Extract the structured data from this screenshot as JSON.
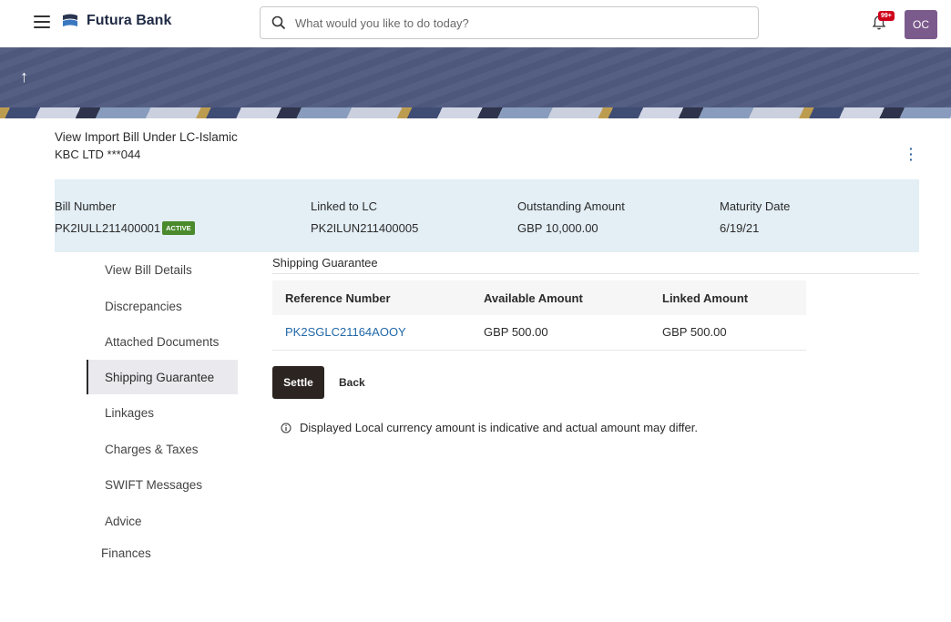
{
  "header": {
    "brand_name": "Futura Bank",
    "search_placeholder": "What would you like to do today?",
    "notification_badge": "99+",
    "avatar_initials": "OC"
  },
  "page": {
    "title": "View Import Bill Under LC-Islamic",
    "subtitle": "KBC LTD  ***044"
  },
  "summary": {
    "bill_number_label": "Bill Number",
    "bill_number_value": "PK2IULL211400001",
    "status": "ACTIVE",
    "linked_lc_label": "Linked to LC",
    "linked_lc_value": "PK2ILUN211400005",
    "outstanding_label": "Outstanding Amount",
    "outstanding_value": "GBP 10,000.00",
    "maturity_label": "Maturity Date",
    "maturity_value": "6/19/21"
  },
  "nav": {
    "items": [
      {
        "label": "View Bill Details"
      },
      {
        "label": "Discrepancies"
      },
      {
        "label": "Attached Documents"
      },
      {
        "label": "Shipping Guarantee"
      },
      {
        "label": "Linkages"
      },
      {
        "label": "Charges & Taxes"
      },
      {
        "label": "SWIFT Messages"
      },
      {
        "label": "Advice"
      },
      {
        "label": "Finances"
      }
    ],
    "active_index": 3
  },
  "content": {
    "section_title": "Shipping Guarantee",
    "table": {
      "headers": [
        "Reference Number",
        "Available Amount",
        "Linked Amount"
      ],
      "rows": [
        [
          "PK2SGLC21164AOOY",
          "GBP 500.00",
          "GBP 500.00"
        ]
      ]
    },
    "settle_label": "Settle",
    "back_label": "Back",
    "note": "Displayed Local currency amount is indicative and actual amount may differ."
  },
  "colors": {
    "banner": "#505a80",
    "summary_bg": "#e3eef5",
    "status_green": "#4a8a2c",
    "link_blue": "#2268a8",
    "primary_button": "#2b2420"
  }
}
